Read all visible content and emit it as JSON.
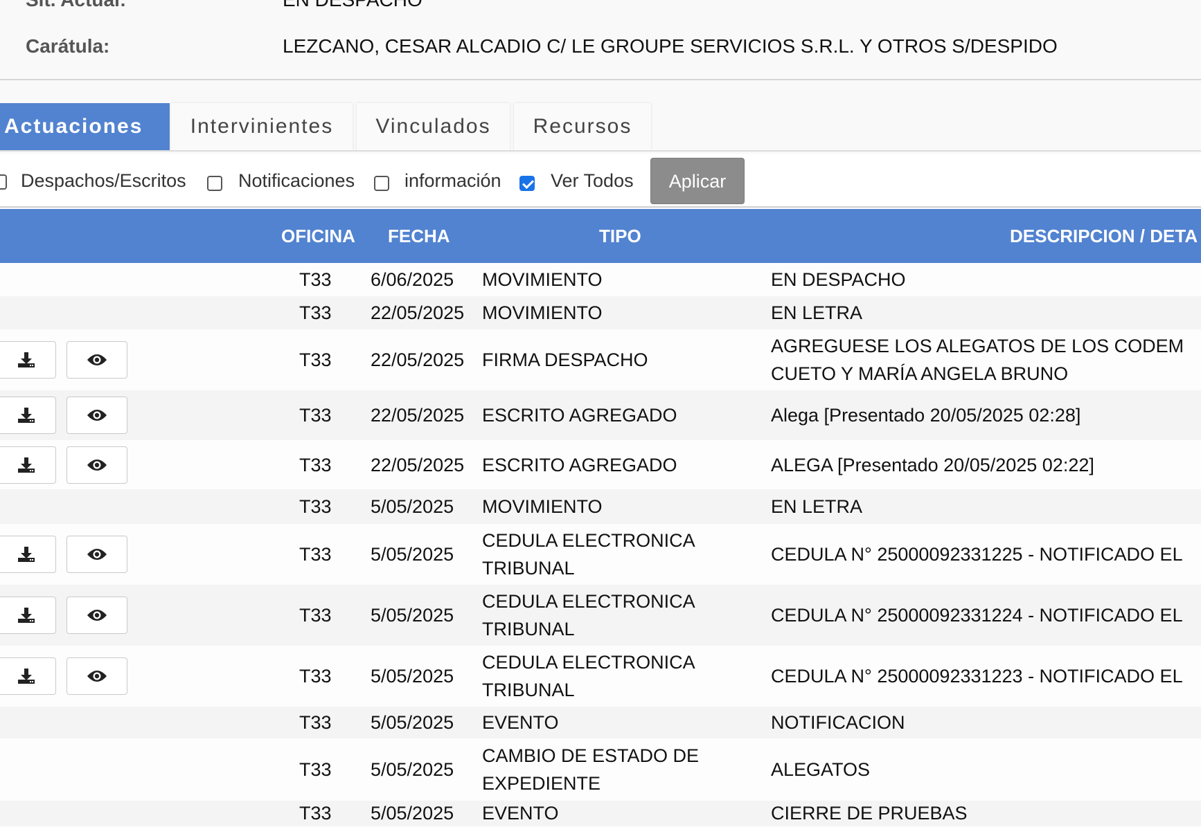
{
  "header": {
    "sit_label": "Sit. Actual:",
    "sit_value": "EN DESPACHO",
    "caratula_label": "Carátula:",
    "caratula_value": "LEZCANO, CESAR ALCADIO C/ LE GROUPE SERVICIOS S.R.L. Y OTROS S/DESPIDO"
  },
  "tabs": [
    {
      "label": "Actuaciones",
      "active": true
    },
    {
      "label": "Intervinientes",
      "active": false
    },
    {
      "label": "Vinculados",
      "active": false
    },
    {
      "label": "Recursos",
      "active": false
    }
  ],
  "filters": {
    "items": [
      {
        "label": "Despachos/Escritos",
        "checked": false
      },
      {
        "label": "Notificaciones",
        "checked": false
      },
      {
        "label": "información",
        "checked": false
      },
      {
        "label": "Ver Todos",
        "checked": true
      }
    ],
    "apply_label": "Aplicar"
  },
  "table": {
    "columns": [
      "OFICINA",
      "FECHA",
      "TIPO",
      "DESCRIPCION / DETA"
    ],
    "rows": [
      {
        "oficina": "T33",
        "fecha": "6/06/2025",
        "tipo": [
          "MOVIMIENTO"
        ],
        "descripcion": [
          "EN DESPACHO"
        ],
        "actions": false
      },
      {
        "oficina": "T33",
        "fecha": "22/05/2025",
        "tipo": [
          "MOVIMIENTO"
        ],
        "descripcion": [
          "EN LETRA"
        ],
        "actions": false
      },
      {
        "oficina": "T33",
        "fecha": "22/05/2025",
        "tipo": [
          "FIRMA DESPACHO"
        ],
        "descripcion": [
          "AGREGUESE LOS ALEGATOS DE LOS CODEM",
          "CUETO Y MARÍA ANGELA BRUNO"
        ],
        "actions": true
      },
      {
        "oficina": "T33",
        "fecha": "22/05/2025",
        "tipo": [
          "ESCRITO AGREGADO"
        ],
        "descripcion": [
          "Alega [Presentado 20/05/2025 02:28]"
        ],
        "actions": true
      },
      {
        "oficina": "T33",
        "fecha": "22/05/2025",
        "tipo": [
          "ESCRITO AGREGADO"
        ],
        "descripcion": [
          "ALEGA [Presentado 20/05/2025 02:22]"
        ],
        "actions": true
      },
      {
        "oficina": "T33",
        "fecha": "5/05/2025",
        "tipo": [
          "MOVIMIENTO"
        ],
        "descripcion": [
          "EN LETRA"
        ],
        "actions": false
      },
      {
        "oficina": "T33",
        "fecha": "5/05/2025",
        "tipo": [
          "CEDULA ELECTRONICA",
          "TRIBUNAL"
        ],
        "descripcion": [
          "CEDULA N° 25000092331225 - NOTIFICADO EL"
        ],
        "actions": true
      },
      {
        "oficina": "T33",
        "fecha": "5/05/2025",
        "tipo": [
          "CEDULA ELECTRONICA",
          "TRIBUNAL"
        ],
        "descripcion": [
          "CEDULA N° 25000092331224 - NOTIFICADO EL"
        ],
        "actions": true
      },
      {
        "oficina": "T33",
        "fecha": "5/05/2025",
        "tipo": [
          "CEDULA ELECTRONICA",
          "TRIBUNAL"
        ],
        "descripcion": [
          "CEDULA N° 25000092331223 - NOTIFICADO EL"
        ],
        "actions": true
      },
      {
        "oficina": "T33",
        "fecha": "5/05/2025",
        "tipo": [
          "EVENTO"
        ],
        "descripcion": [
          "NOTIFICACION"
        ],
        "actions": false
      },
      {
        "oficina": "T33",
        "fecha": "5/05/2025",
        "tipo": [
          "CAMBIO DE ESTADO DE",
          "EXPEDIENTE"
        ],
        "descripcion": [
          "ALEGATOS"
        ],
        "actions": false
      },
      {
        "oficina": "T33",
        "fecha": "5/05/2025",
        "tipo": [
          "EVENTO"
        ],
        "descripcion": [
          "CIERRE DE PRUEBAS"
        ],
        "actions": false
      }
    ]
  },
  "icons": {
    "download": "download-icon",
    "view": "eye-icon"
  },
  "colors": {
    "accent": "#5283d0",
    "apply_button": "#8c8c8c",
    "checkbox_checked": "#1a73e8"
  }
}
